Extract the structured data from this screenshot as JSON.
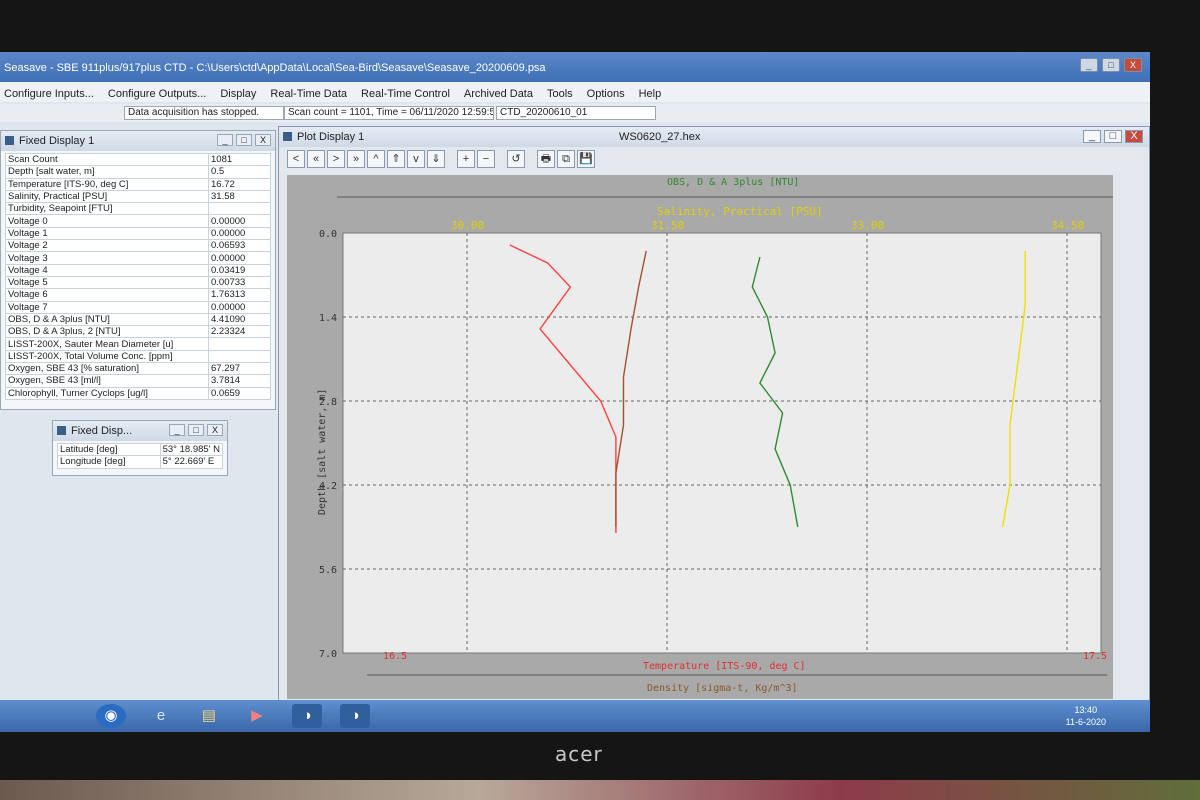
{
  "window": {
    "title": "Seasave - SBE 911plus/917plus CTD - C:\\Users\\ctd\\AppData\\Local\\Sea-Bird\\Seasave\\Seasave_20200609.psa",
    "minimize_label": "_",
    "maximize_label": "□",
    "close_label": "X"
  },
  "menu": [
    "Configure Inputs...",
    "Configure Outputs...",
    "Display",
    "Real-Time Data",
    "Real-Time Control",
    "Archived Data",
    "Tools",
    "Options",
    "Help"
  ],
  "status": {
    "message": "Data acquisition has stopped.",
    "scan_info": "Scan count = 1101, Time = 06/11/2020 12:59:58",
    "file": "CTD_20200610_01"
  },
  "fixed_display_1": {
    "title": "Fixed Display 1",
    "rows": [
      {
        "label": "Scan Count",
        "value": "1081"
      },
      {
        "label": "Depth [salt water, m]",
        "value": "0.5"
      },
      {
        "label": "Temperature [ITS-90, deg C]",
        "value": "16.72"
      },
      {
        "label": "Salinity, Practical [PSU]",
        "value": "31.58"
      },
      {
        "label": "Turbidity, Seapoint [FTU]",
        "value": ""
      },
      {
        "label": "Voltage 0",
        "value": "0.00000"
      },
      {
        "label": "Voltage 1",
        "value": "0.00000"
      },
      {
        "label": "Voltage 2",
        "value": "0.06593"
      },
      {
        "label": "Voltage 3",
        "value": "0.00000"
      },
      {
        "label": "Voltage 4",
        "value": "0.03419"
      },
      {
        "label": "Voltage 5",
        "value": "0.00733"
      },
      {
        "label": "Voltage 6",
        "value": "1.76313"
      },
      {
        "label": "Voltage 7",
        "value": "0.00000"
      },
      {
        "label": "OBS, D & A 3plus [NTU]",
        "value": "4.41090"
      },
      {
        "label": "OBS, D & A 3plus, 2 [NTU]",
        "value": "2.23324"
      },
      {
        "label": "LISST-200X, Sauter Mean Diameter [u]",
        "value": ""
      },
      {
        "label": "LISST-200X, Total Volume Conc. [ppm]",
        "value": ""
      },
      {
        "label": "Oxygen, SBE 43 [% saturation]",
        "value": "67.297"
      },
      {
        "label": "Oxygen, SBE 43 [ml/l]",
        "value": "3.7814"
      },
      {
        "label": "Chlorophyll, Turner Cyclops [ug/l]",
        "value": "0.0659"
      }
    ]
  },
  "fixed_display_2": {
    "title": "Fixed Disp...",
    "rows": [
      {
        "label": "Latitude [deg]",
        "value": "53° 18.985' N"
      },
      {
        "label": "Longitude [deg]",
        "value": "5° 22.669' E"
      }
    ]
  },
  "plot_display": {
    "title": "Plot Display 1",
    "file": "WS0620_27.hex",
    "toolbar": [
      "<",
      "«",
      ">",
      "»",
      "^",
      "⇑",
      "v",
      "⇓",
      "+",
      "−",
      "↺",
      "🖶",
      "⧉",
      "💾"
    ]
  },
  "chart_data": {
    "type": "line",
    "title": "",
    "ylabel": "Depth [salt water, m]",
    "ylim": [
      0.0,
      7.0
    ],
    "y_ticks": [
      "0.0",
      "1.4",
      "2.8",
      "4.2",
      "5.6",
      "7.0"
    ],
    "top_axis_1": {
      "label": "OBS, D & A 3plus [NTU]",
      "color": "#2e8b2e"
    },
    "top_axis_2": {
      "label": "Salinity, Practical [PSU]",
      "color": "#e0d000",
      "ticks": [
        "30.00",
        "31.50",
        "33.00",
        "34.50"
      ],
      "xlim": [
        28.5,
        34.5
      ]
    },
    "bottom_axis_1": {
      "label": "Temperature [ITS-90, deg C]",
      "color": "#e03030",
      "ticks": [
        "16.5",
        "",
        "",
        "17.5"
      ]
    },
    "bottom_axis_2": {
      "label": "Density [sigma-t, Kg/m^3]",
      "color": "#8b5a2b"
    },
    "grid": true,
    "series": [
      {
        "color": "#2e8b2e",
        "points": [
          [
            0.55,
            0.4
          ],
          [
            0.54,
            0.9
          ],
          [
            0.56,
            1.4
          ],
          [
            0.57,
            2.0
          ],
          [
            0.55,
            2.5
          ],
          [
            0.58,
            3.0
          ],
          [
            0.57,
            3.6
          ],
          [
            0.59,
            4.2
          ],
          [
            0.6,
            4.9
          ]
        ]
      },
      {
        "color": "#ff4040",
        "points": [
          [
            0.22,
            0.2
          ],
          [
            0.27,
            0.5
          ],
          [
            0.3,
            0.9
          ],
          [
            0.26,
            1.6
          ],
          [
            0.3,
            2.2
          ],
          [
            0.34,
            2.8
          ],
          [
            0.36,
            3.4
          ],
          [
            0.36,
            4.2
          ],
          [
            0.36,
            5.0
          ]
        ]
      },
      {
        "color": "#f0e000",
        "points": [
          [
            0.9,
            0.3
          ],
          [
            0.9,
            1.2
          ],
          [
            0.89,
            2.2
          ],
          [
            0.88,
            3.2
          ],
          [
            0.88,
            4.2
          ],
          [
            0.87,
            4.9
          ]
        ]
      },
      {
        "color": "#a0522d",
        "points": [
          [
            0.4,
            0.3
          ],
          [
            0.39,
            0.9
          ],
          [
            0.38,
            1.6
          ],
          [
            0.37,
            2.4
          ],
          [
            0.37,
            3.2
          ],
          [
            0.36,
            4.0
          ],
          [
            0.36,
            4.9
          ]
        ]
      }
    ]
  },
  "taskbar": {
    "start_icon": "◉",
    "apps": [
      "e",
      "▤",
      "▶",
      "◑",
      "◑"
    ],
    "time": "13:40",
    "date": "11-6-2020"
  },
  "monitor_brand": "acer"
}
